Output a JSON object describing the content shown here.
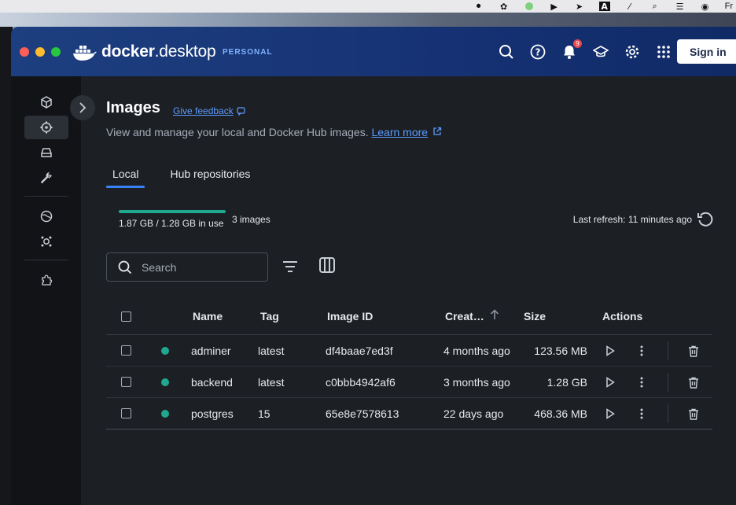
{
  "menubar": {
    "right_text": "Fr"
  },
  "app": {
    "logo_text_bold": "docker",
    "logo_text_light": ".desktop",
    "plan": "PERSONAL",
    "sign_in": "Sign in",
    "notification_count": "9"
  },
  "page": {
    "title": "Images",
    "feedback": "Give feedback",
    "subtitle": "View and manage your local and Docker Hub images.",
    "learn_more": "Learn more"
  },
  "tabs": [
    {
      "label": "Local"
    },
    {
      "label": "Hub repositories"
    }
  ],
  "usage": {
    "text": "1.87 GB / 1.28 GB in use",
    "count": "3 images",
    "bar_fraction": 1.0,
    "last_refresh": "Last refresh: 11 minutes ago"
  },
  "search": {
    "placeholder": "Search"
  },
  "table": {
    "headers": {
      "name": "Name",
      "tag": "Tag",
      "image_id": "Image ID",
      "created": "Creat…",
      "size": "Size",
      "actions": "Actions"
    },
    "rows": [
      {
        "name": "adminer",
        "tag": "latest",
        "image_id": "df4baae7ed3f",
        "created": "4 months ago",
        "size": "123.56 MB"
      },
      {
        "name": "backend",
        "tag": "latest",
        "image_id": "c0bbb4942af6",
        "created": "3 months ago",
        "size": "1.28 GB"
      },
      {
        "name": "postgres",
        "tag": "15",
        "image_id": "65e8e7578613",
        "created": "22 days ago",
        "size": "468.36 MB"
      }
    ]
  },
  "colors": {
    "titlebar": "#163274",
    "accent": "#3b82f6",
    "in_use": "#1fa88f"
  }
}
